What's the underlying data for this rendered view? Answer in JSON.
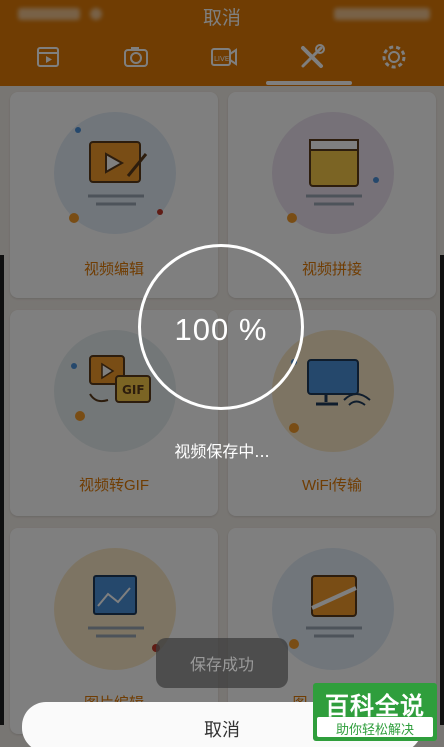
{
  "statusbar": {
    "title": "取消"
  },
  "tabs": [
    {
      "icon": "video-clip-icon"
    },
    {
      "icon": "camera-icon"
    },
    {
      "icon": "live-camera-icon"
    },
    {
      "icon": "tools-icon",
      "active": true
    },
    {
      "icon": "settings-gear-icon"
    }
  ],
  "cards": [
    {
      "label": "视频编辑",
      "icon": "video-edit-icon"
    },
    {
      "label": "视频拼接",
      "icon": "video-merge-icon"
    },
    {
      "label": "视频转GIF",
      "icon": "video-to-gif-icon",
      "badge": "GIF"
    },
    {
      "label": "WiFi传输",
      "icon": "wifi-transfer-icon"
    },
    {
      "label": "图片编辑",
      "icon": "image-edit-icon"
    },
    {
      "label": "图",
      "icon": "image-crop-icon"
    }
  ],
  "progress": {
    "percent_text": "100 %",
    "percent": 100,
    "message": "视频保存中..."
  },
  "toast": {
    "text": "保存成功"
  },
  "cancel_button": {
    "label": "取消"
  },
  "watermark": {
    "big": "百科全说",
    "small": "助你轻松解决"
  },
  "colors": {
    "accent": "#e07a06",
    "overlay": "rgba(0,0,0,0.5)",
    "watermark": "#2f9e3c"
  }
}
